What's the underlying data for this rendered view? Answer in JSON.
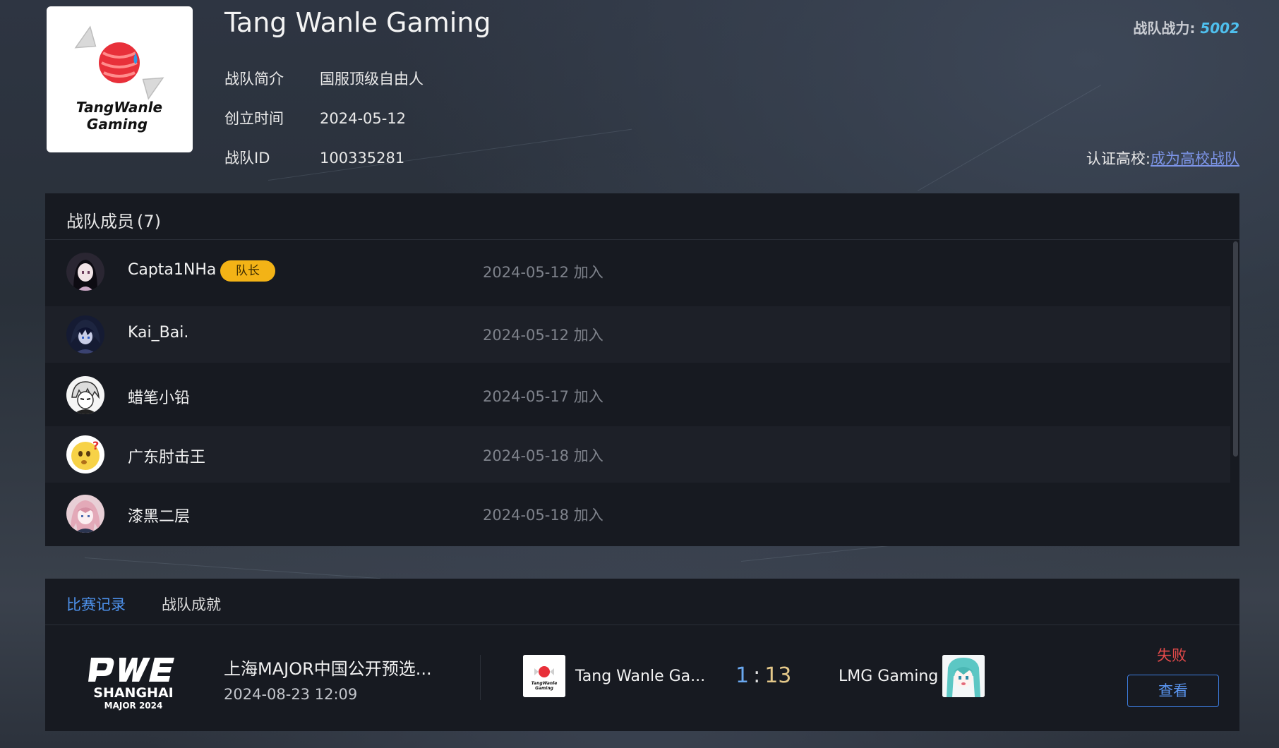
{
  "team": {
    "name": "Tang Wanle Gaming",
    "logo_text_line1": "TangWanle",
    "logo_text_line2": "Gaming",
    "power_label": "战队战力:",
    "power_value": "5002",
    "info": [
      {
        "label": "战队简介",
        "value": "国服顶级自由人"
      },
      {
        "label": "创立时间",
        "value": "2024-05-12"
      },
      {
        "label": "战队ID",
        "value": "100335281"
      }
    ],
    "cert_label": "认证高校:",
    "cert_link": "成为高校战队"
  },
  "members": {
    "title": "战队成员",
    "count": "(7)",
    "captain_badge": "队长",
    "items": [
      {
        "name": "Capta1NHa",
        "joined": "2024-05-12 加入",
        "captain": true
      },
      {
        "name": "Kai_Bai.",
        "joined": "2024-05-12 加入",
        "captain": false
      },
      {
        "name": "蜡笔小铅",
        "joined": "2024-05-17 加入",
        "captain": false
      },
      {
        "name": "广东肘击王",
        "joined": "2024-05-18 加入",
        "captain": false
      },
      {
        "name": "漆黑二层",
        "joined": "2024-05-18 加入",
        "captain": false
      }
    ]
  },
  "matches": {
    "tabs": [
      {
        "label": "比赛记录",
        "active": true
      },
      {
        "label": "战队成就",
        "active": false
      }
    ],
    "items": [
      {
        "event_logo_text": "SHANGHAI",
        "event_logo_sub": "MAJOR 2024",
        "event_name": "上海MAJOR中国公开预选...",
        "time": "2024-08-23 12:09",
        "team_a": "Tang Wanle Ga...",
        "score_a": "1",
        "score_sep": ":",
        "score_b": "13",
        "team_b": "LMG Gaming",
        "result": "失败",
        "view_label": "查看"
      }
    ]
  },
  "colors": {
    "accent": "#4e93ee",
    "power": "#4fc0ee",
    "captain_badge": "#f3b316",
    "loss": "#e44a4a",
    "panel": "#171a21"
  }
}
